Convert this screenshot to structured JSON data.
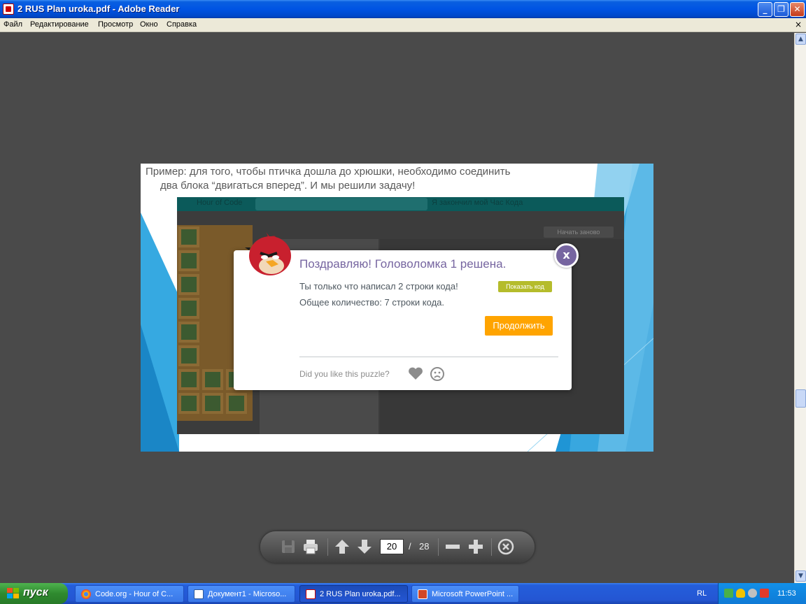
{
  "window": {
    "title": "2 RUS Plan uroka.pdf - Adobe Reader",
    "minimize_glyph": "_",
    "maximize_glyph": "❐",
    "close_glyph": "✕"
  },
  "menu": {
    "items": [
      "Файл",
      "Редактирование",
      "Просмотр",
      "Окно",
      "Справка"
    ],
    "close_glyph": "×"
  },
  "slide": {
    "caption_line1": "Пример: для того, чтобы птичка дошла до хрюшки, необходимо соединить",
    "caption_line2": "два блока “двигаться вперед”. И мы решили задачу!",
    "game": {
      "top_left": "Hour of Code",
      "top_right": "Я закончил мой Час Кода",
      "restart": "Начать заново"
    },
    "dialog": {
      "title": "Поздравляю! Головоломка 1 решена.",
      "line1": "Ты только что написал 2 строки кода!",
      "line2": "Общее количество: 7 строки кода.",
      "show_code": "Показать код",
      "continue": "Продолжить",
      "feedback_question": "Did you like this puzzle?",
      "close_label": "x",
      "icons": [
        "heart-icon",
        "sad-face-icon",
        "angry-bird-icon"
      ]
    }
  },
  "toolbar": {
    "current_page": "20",
    "separator": "/",
    "total_pages": "28",
    "icons": [
      "save-icon",
      "print-icon",
      "arrow-up-icon",
      "arrow-down-icon",
      "zoom-out-icon",
      "zoom-in-icon",
      "close-circle-icon"
    ]
  },
  "taskbar": {
    "start_label": "пуск",
    "tasks": [
      {
        "label": "Code.org - Hour of C...",
        "icon": "chrome-icon"
      },
      {
        "label": "Документ1 - Microso...",
        "icon": "word-icon"
      },
      {
        "label": "2 RUS Plan uroka.pdf...",
        "icon": "pdf-icon"
      },
      {
        "label": "Microsoft PowerPoint ...",
        "icon": "powerpoint-icon"
      }
    ],
    "language": "RL",
    "time": "11:53"
  },
  "colors": {
    "title_bar": "#0054e3",
    "dialog_title": "#7665a0",
    "continue_button": "#ffa400",
    "show_code_button": "#b5bc2b",
    "slide_accent": "#1fa3dc"
  }
}
